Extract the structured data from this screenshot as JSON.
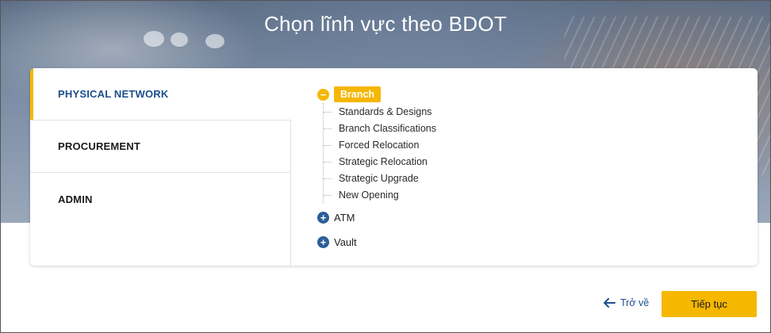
{
  "page": {
    "title": "Chọn lĩnh vực theo BDOT"
  },
  "sidebar": {
    "items": [
      {
        "label": "PHYSICAL NETWORK",
        "active": true
      },
      {
        "label": "PROCUREMENT",
        "active": false
      },
      {
        "label": "ADMIN",
        "active": false
      }
    ]
  },
  "tree": {
    "nodes": [
      {
        "label": "Branch",
        "expanded": true,
        "icon": "minus-circle-icon",
        "children": [
          "Standards & Designs",
          "Branch Classifications",
          "Forced Relocation",
          "Strategic Relocation",
          "Strategic Upgrade",
          "New Opening"
        ]
      },
      {
        "label": "ATM",
        "expanded": false,
        "icon": "plus-circle-icon"
      },
      {
        "label": "Vault",
        "expanded": false,
        "icon": "plus-circle-icon"
      }
    ]
  },
  "footer": {
    "back_label": "Trở về",
    "next_label": "Tiếp tục"
  },
  "colors": {
    "accent": "#f5b700",
    "primary": "#1d4f8c",
    "plus_icon": "#2b5d99"
  }
}
